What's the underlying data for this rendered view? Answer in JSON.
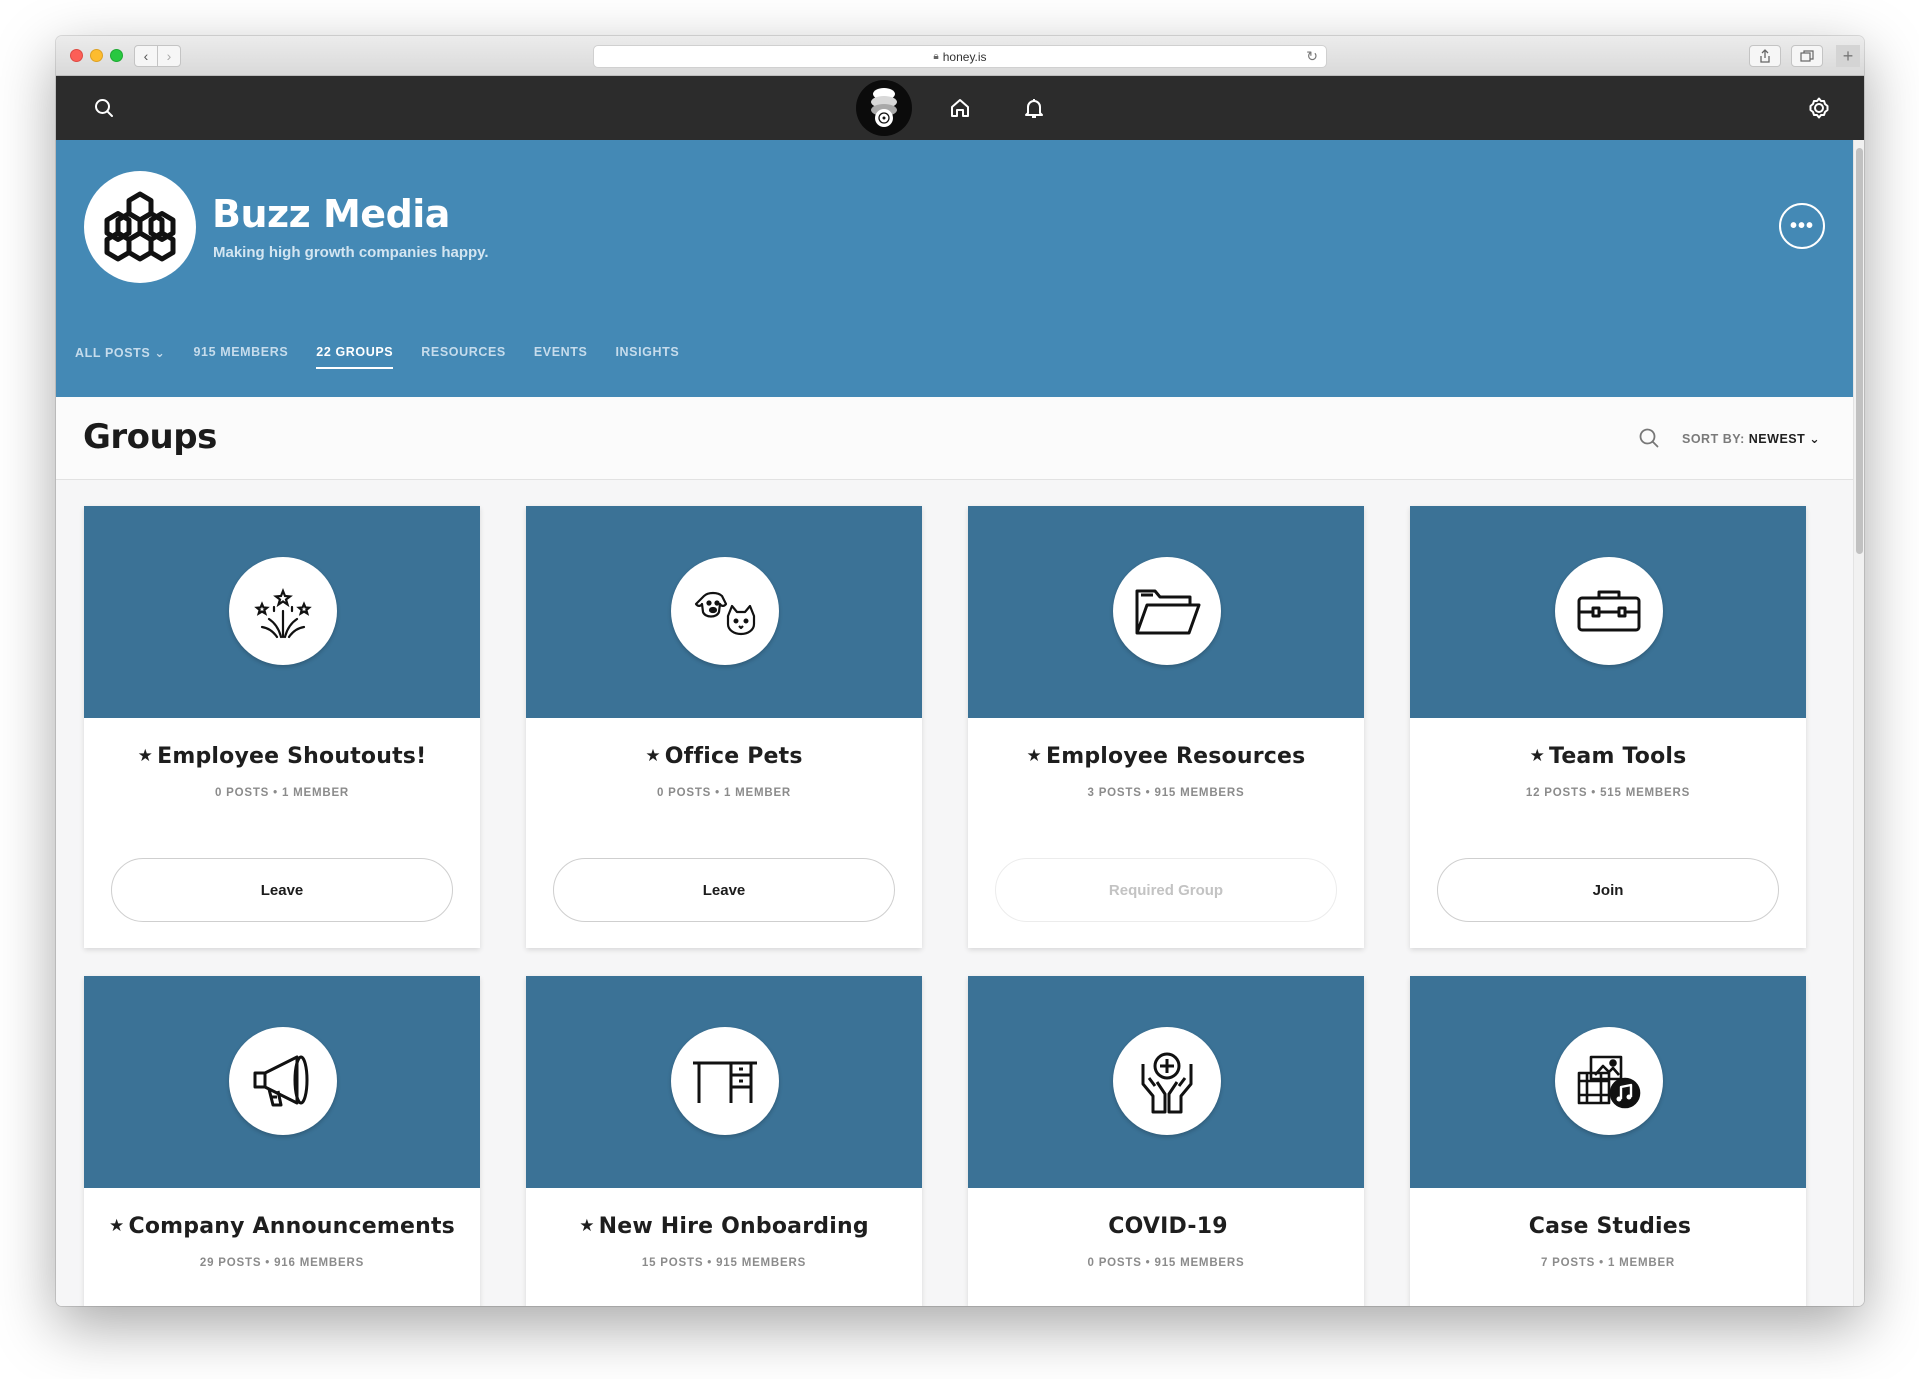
{
  "browser": {
    "url": "honey.is"
  },
  "topbar": {
    "icons": [
      "search-icon",
      "home-icon",
      "bell-icon",
      "gear-icon"
    ]
  },
  "hero": {
    "title": "Buzz Media",
    "subtitle": "Making high growth companies happy.",
    "more_label": "•••",
    "tabs": [
      {
        "label": "ALL POSTS ⌄"
      },
      {
        "label": "915 MEMBERS"
      },
      {
        "label": "22 GROUPS"
      },
      {
        "label": "RESOURCES"
      },
      {
        "label": "EVENTS"
      },
      {
        "label": "INSIGHTS"
      }
    ],
    "active_tab": "22 GROUPS"
  },
  "groups_header": {
    "title": "Groups",
    "sort_label": "SORT BY:",
    "sort_value": "NEWEST"
  },
  "cards": [
    {
      "starred": true,
      "star": "★",
      "name": "Employee Shoutouts!",
      "meta": "0 POSTS • 1 MEMBER",
      "button": "Leave",
      "icon": "fireworks-icon"
    },
    {
      "starred": true,
      "star": "★",
      "name": "Office Pets",
      "meta": "0 POSTS • 1 MEMBER",
      "button": "Leave",
      "icon": "pets-icon"
    },
    {
      "starred": true,
      "star": "★",
      "name": "Employee Resources",
      "meta": "3 POSTS • 915 MEMBERS",
      "button": "Required Group",
      "icon": "folder-icon"
    },
    {
      "starred": true,
      "star": "★",
      "name": "Team Tools",
      "meta": "12 POSTS • 515 MEMBERS",
      "button": "Join",
      "icon": "toolbox-icon"
    },
    {
      "starred": true,
      "star": "★",
      "name": "Company Announcements",
      "meta": "29 POSTS • 916 MEMBERS",
      "icon": "megaphone-icon"
    },
    {
      "starred": true,
      "star": "★",
      "name": "New Hire Onboarding",
      "meta": "15 POSTS • 915 MEMBERS",
      "icon": "desk-icon"
    },
    {
      "starred": false,
      "star": "",
      "name": "COVID-19",
      "meta": "0 POSTS • 915 MEMBERS",
      "icon": "health-hands-icon"
    },
    {
      "starred": false,
      "star": "",
      "name": "Case Studies",
      "meta": "7 POSTS • 1 MEMBER",
      "icon": "media-icon"
    }
  ],
  "colors": {
    "topbar": "#2c2c2c",
    "hero": "#4489b5",
    "card_banner": "#3b7296"
  }
}
